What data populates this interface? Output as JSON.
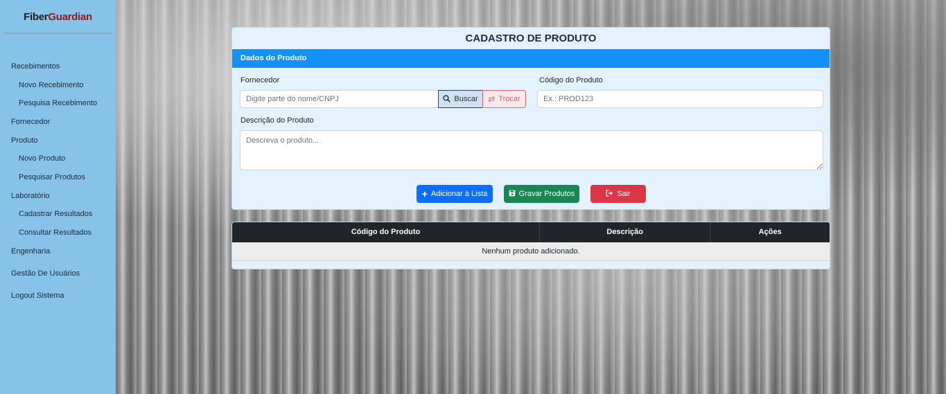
{
  "brand": {
    "part1": "Fiber",
    "part2": "Guardian"
  },
  "sidebar": {
    "items": [
      {
        "label": "Recebimentos"
      },
      {
        "label": "Novo Recebimento"
      },
      {
        "label": "Pesquisa Recebimento"
      },
      {
        "label": "Fornecedor"
      },
      {
        "label": "Produto"
      },
      {
        "label": "Novo Produto"
      },
      {
        "label": "Pesquisar Produtos"
      },
      {
        "label": "Laboratório"
      },
      {
        "label": "Cadastrar Resultados"
      },
      {
        "label": "Consultar Resultados"
      },
      {
        "label": "Engenharia"
      },
      {
        "label": "Gestão De Usuários"
      },
      {
        "label": "Logout Sistema"
      }
    ]
  },
  "form": {
    "title": "CADASTRO DE PRODUTO",
    "section": "Dados do Produto",
    "fornecedor_label": "Fornecedor",
    "fornecedor_placeholder": "Digite parte do nome/CNPJ",
    "buscar_label": "Buscar",
    "trocar_label": "Trocar",
    "codigo_label": "Código do Produto",
    "codigo_placeholder": "Ex.: PROD123",
    "descricao_label": "Descrição do Produto",
    "descricao_placeholder": "Descreva o produto...",
    "add_label": "Adicionar à Lista",
    "save_label": "Gravar Produtos",
    "exit_label": "Sair"
  },
  "table": {
    "columns": [
      "Código do Produto",
      "Descrição",
      "Ações"
    ],
    "empty_text": "Nenhum produto adicionado."
  },
  "colors": {
    "sidebar": "#87c3e9",
    "section_bar": "#1491f7",
    "add_button": "#0d6efd",
    "save_button": "#198754",
    "exit_button": "#dc3545",
    "table_header": "#212529"
  }
}
